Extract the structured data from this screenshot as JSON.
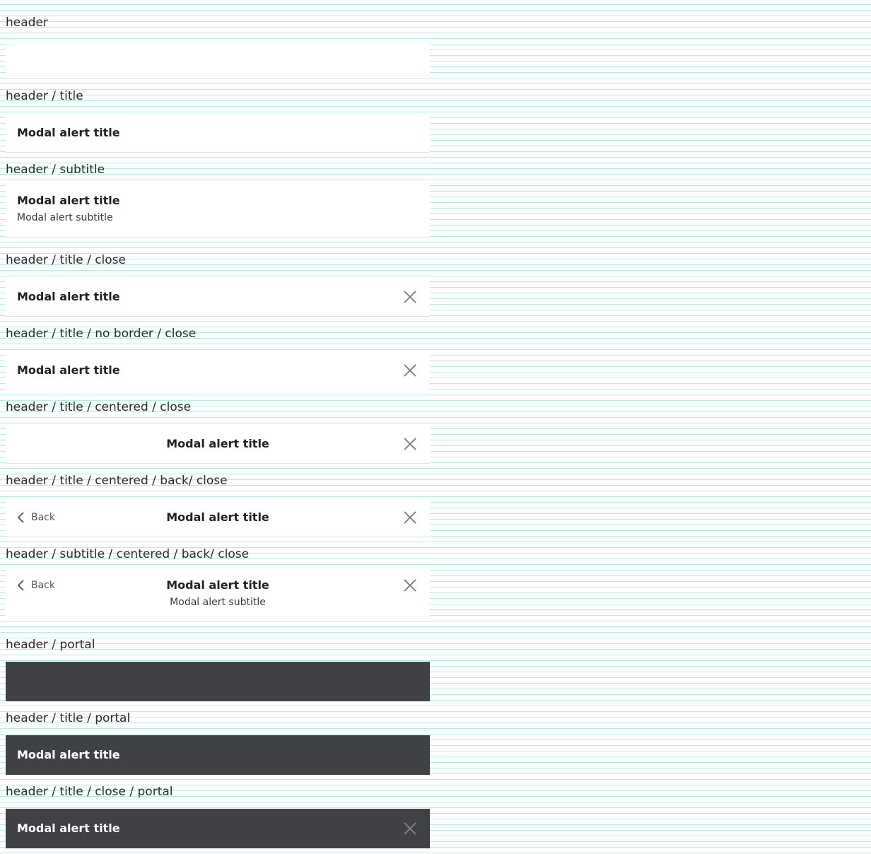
{
  "sections": [
    {
      "label": "header"
    },
    {
      "label": "header / title",
      "title": "Modal alert title"
    },
    {
      "label": "header / subtitle",
      "title": "Modal alert title",
      "subtitle": "Modal alert subtitle"
    },
    {
      "label": "header / title / close",
      "title": "Modal alert title",
      "close_icon": "close-icon"
    },
    {
      "label": "header / title / no border / close",
      "title": "Modal alert title",
      "close_icon": "close-icon"
    },
    {
      "label": "header / title / centered / close",
      "title": "Modal alert title",
      "close_icon": "close-icon"
    },
    {
      "label": "header / title / centered / back/ close",
      "title": "Modal alert title",
      "back_label": "Back",
      "back_icon": "chevron-left-icon",
      "close_icon": "close-icon"
    },
    {
      "label": "header / subtitle / centered / back/ close",
      "title": "Modal alert title",
      "subtitle": "Modal alert subtitle",
      "back_label": "Back",
      "back_icon": "chevron-left-icon",
      "close_icon": "close-icon"
    },
    {
      "label": "header / portal"
    },
    {
      "label": "header / title / portal",
      "title": "Modal alert title"
    },
    {
      "label": "header / title / close / portal",
      "title": "Modal alert title",
      "close_icon": "close-icon"
    }
  ],
  "colors": {
    "background": "#ffffff",
    "grid_line": "#aeeee6",
    "panel": "#ffffff",
    "portal_panel": "#404145",
    "text": "#222222",
    "portal_text": "#ffffff",
    "icon": "#777777",
    "divider": "#e2e2e2"
  }
}
